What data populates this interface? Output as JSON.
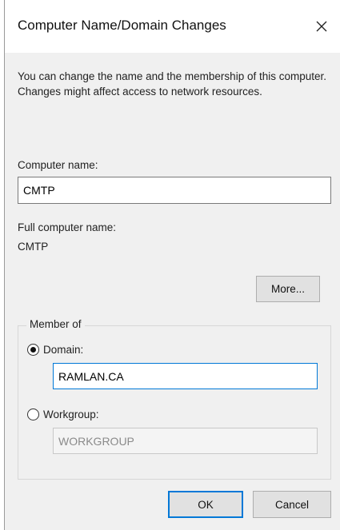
{
  "window": {
    "title": "Computer Name/Domain Changes"
  },
  "description": "You can change the name and the membership of this computer. Changes might affect access to network resources.",
  "computer_name": {
    "label": "Computer name:",
    "value": "CMTP"
  },
  "full_computer_name": {
    "label": "Full computer name:",
    "value": "CMTP"
  },
  "more_button": "More...",
  "member_of": {
    "legend": "Member of",
    "domain": {
      "label": "Domain:",
      "value": "RAMLAN.CA",
      "selected": true
    },
    "workgroup": {
      "label": "Workgroup:",
      "value": "WORKGROUP",
      "selected": false
    }
  },
  "buttons": {
    "ok": "OK",
    "cancel": "Cancel"
  },
  "icons": {
    "close": "close-icon"
  }
}
